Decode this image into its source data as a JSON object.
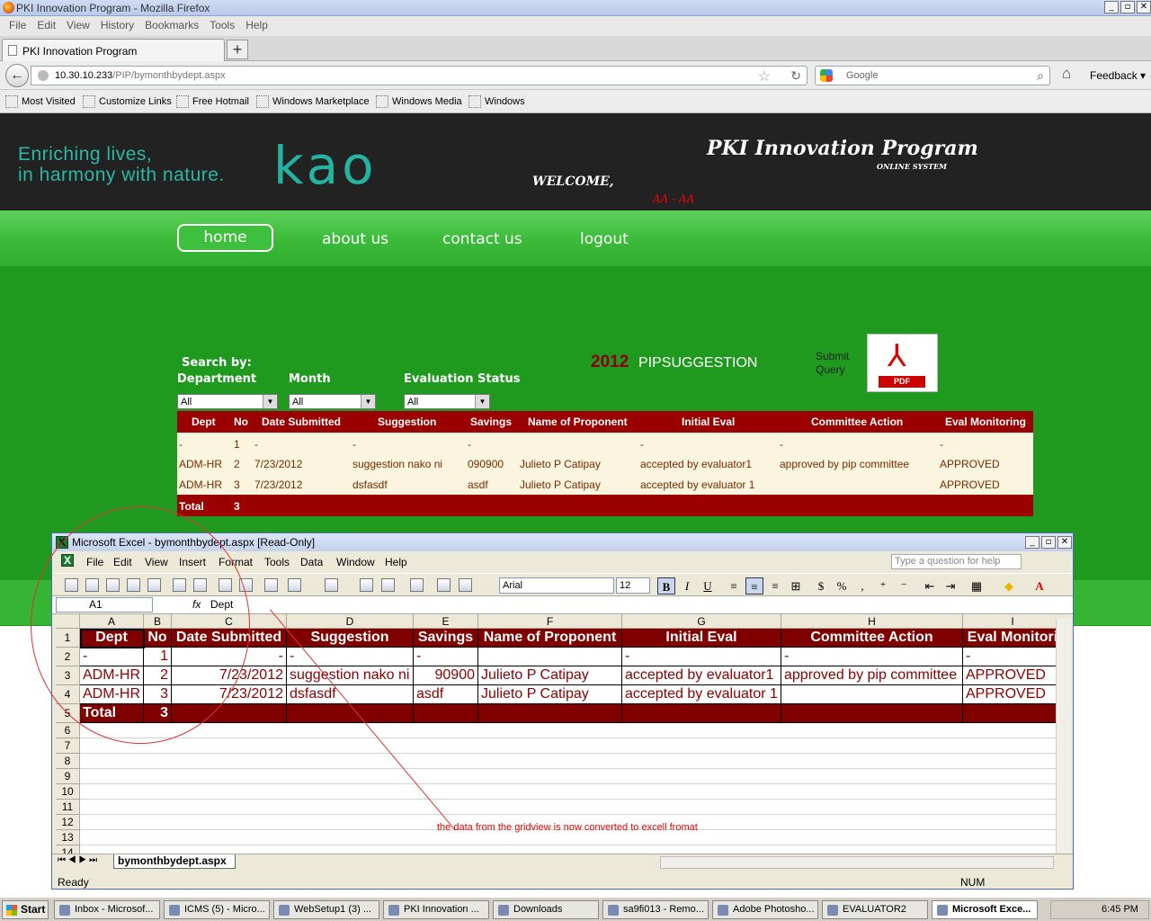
{
  "browser": {
    "title": "PKI Innovation Program - Mozilla Firefox",
    "menu": [
      "File",
      "Edit",
      "View",
      "History",
      "Bookmarks",
      "Tools",
      "Help"
    ],
    "tab": "PKI Innovation Program",
    "url_host": "10.30.10.233",
    "url_path": "/PIP/bymonthbydept.aspx",
    "search_placeholder": "Google",
    "feedback": "Feedback",
    "bookmarks": [
      "Most Visited",
      "Customize Links",
      "Free Hotmail",
      "Windows Marketplace",
      "Windows Media",
      "Windows"
    ]
  },
  "site": {
    "tagline1": "Enriching lives,",
    "tagline2": "in harmony with nature.",
    "logo": "kao",
    "program": "PKI Innovation Program",
    "system": "ONLINE SYSTEM",
    "welcome": "WELCOME,",
    "user": "AA - AA",
    "nav": [
      "home",
      "about us",
      "contact us",
      "logout"
    ]
  },
  "search": {
    "title": "Search by:",
    "dept_label": "Department",
    "month_label": "Month",
    "status_label": "Evaluation Status",
    "dept_value": "All",
    "month_value": "All",
    "status_value": "All",
    "year": "2012",
    "heading": "PIPSUGGESTION",
    "submit_query": "Submit Query",
    "pdf_label": "PDF"
  },
  "grid": {
    "headers": [
      "Dept",
      "No",
      "Date Submitted",
      "Suggestion",
      "Savings",
      "Name of Proponent",
      "Initial Eval",
      "Committee Action",
      "Eval Monitoring"
    ],
    "rows": [
      [
        "-",
        "1",
        "-",
        "-",
        "-",
        "",
        "-",
        "-",
        "-"
      ],
      [
        "ADM-HR",
        "2",
        "7/23/2012",
        "suggestion nako ni",
        "090900",
        "Julieto P Catipay",
        "accepted by evaluator1",
        "approved by pip committee",
        "APPROVED"
      ],
      [
        "ADM-HR",
        "3",
        "7/23/2012",
        "dsfasdf",
        "asdf",
        "Julieto P Catipay",
        "accepted by evaluator 1",
        "",
        "APPROVED"
      ]
    ],
    "total_label": "Total",
    "total_value": "3"
  },
  "excel": {
    "title": "Microsoft Excel - bymonthbydept.aspx  [Read-Only]",
    "menu": [
      "File",
      "Edit",
      "View",
      "Insert",
      "Format",
      "Tools",
      "Data",
      "Window",
      "Help"
    ],
    "help_box": "Type a question for help",
    "font": "Arial",
    "size": "12",
    "cell_ref": "A1",
    "formula": "Dept",
    "col_letters": [
      "A",
      "B",
      "C",
      "D",
      "E",
      "F",
      "G",
      "H",
      "I"
    ],
    "headers": [
      "Dept",
      "No",
      "Date Submitted",
      "Suggestion",
      "Savings",
      "Name of Proponent",
      "Initial Eval",
      "Committee Action",
      "Eval Monitori"
    ],
    "rows": [
      [
        "-",
        "1",
        "-",
        "-",
        "-",
        "",
        "-",
        "-",
        "-"
      ],
      [
        "ADM-HR",
        "2",
        "7/23/2012",
        "suggestion nako ni",
        "90900",
        "Julieto P Catipay",
        "accepted by evaluator1",
        "approved by pip committee",
        "APPROVED"
      ],
      [
        "ADM-HR",
        "3",
        "7/23/2012",
        "dsfasdf",
        "asdf",
        "Julieto P Catipay",
        "accepted by evaluator 1",
        "",
        "APPROVED"
      ]
    ],
    "total_label": "Total",
    "total_value": "3",
    "row_numbers": [
      "1",
      "2",
      "3",
      "4",
      "5",
      "6",
      "7",
      "8",
      "9",
      "10",
      "11",
      "12",
      "13",
      "14"
    ],
    "sheet_tab": "bymonthbydept.aspx",
    "status": "Ready",
    "num": "NUM"
  },
  "annotation": "the data from the gridview is now converted to excell fromat",
  "taskbar": {
    "start": "Start",
    "items": [
      "Inbox - Microsof...",
      "ICMS (5) - Micro...",
      "WebSetup1 (3) ...",
      "PKI Innovation ...",
      "Downloads",
      "sa9fi013 - Remo...",
      "Adobe Photosho...",
      "EVALUATOR2",
      "Microsoft Exce..."
    ],
    "time": "6:45 PM"
  }
}
